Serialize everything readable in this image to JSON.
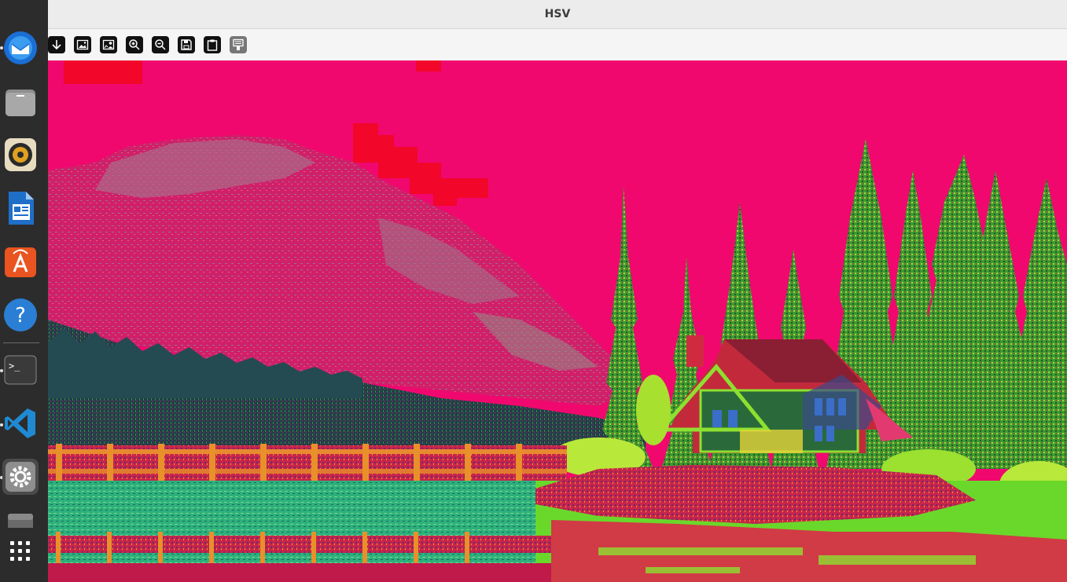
{
  "window": {
    "title": "HSV"
  },
  "dock": {
    "items": [
      {
        "name": "thunderbird",
        "icon": "thunderbird-mail-icon",
        "running": true
      },
      {
        "name": "files",
        "icon": "files-folder-icon",
        "running": false
      },
      {
        "name": "rhythmbox",
        "icon": "rhythmbox-speaker-icon",
        "running": false
      },
      {
        "name": "writer",
        "icon": "libreoffice-writer-icon",
        "running": false
      },
      {
        "name": "software",
        "icon": "app-center-icon",
        "running": false
      },
      {
        "name": "help",
        "icon": "help-question-icon",
        "running": false
      },
      {
        "name": "terminal",
        "icon": "terminal-icon",
        "running": true
      },
      {
        "name": "vscode",
        "icon": "vscode-icon",
        "running": true
      },
      {
        "name": "settings",
        "icon": "settings-gear-icon",
        "running": true
      },
      {
        "name": "drive",
        "icon": "removable-drive-icon",
        "running": false
      },
      {
        "name": "app-grid",
        "icon": "show-apps-grid-icon",
        "running": false
      }
    ]
  },
  "toolbar": {
    "buttons": [
      {
        "name": "download",
        "icon": "arrow-down-icon"
      },
      {
        "name": "image",
        "icon": "image-icon"
      },
      {
        "name": "image-person",
        "icon": "image-person-icon"
      },
      {
        "name": "zoom-in",
        "icon": "zoom-in-icon"
      },
      {
        "name": "zoom-out",
        "icon": "zoom-out-icon"
      },
      {
        "name": "save",
        "icon": "save-floppy-icon"
      },
      {
        "name": "clipboard",
        "icon": "clipboard-icon"
      },
      {
        "name": "properties",
        "icon": "properties-panel-icon"
      }
    ]
  },
  "image": {
    "description_colors": {
      "sky": "#f2086e",
      "mountain": "#c8306c",
      "forest_left": "#1c4a52",
      "trees_right": "#2f8a2a",
      "water": "#29b37a",
      "bridge": "#e2204a",
      "island": "#b4304c"
    }
  }
}
